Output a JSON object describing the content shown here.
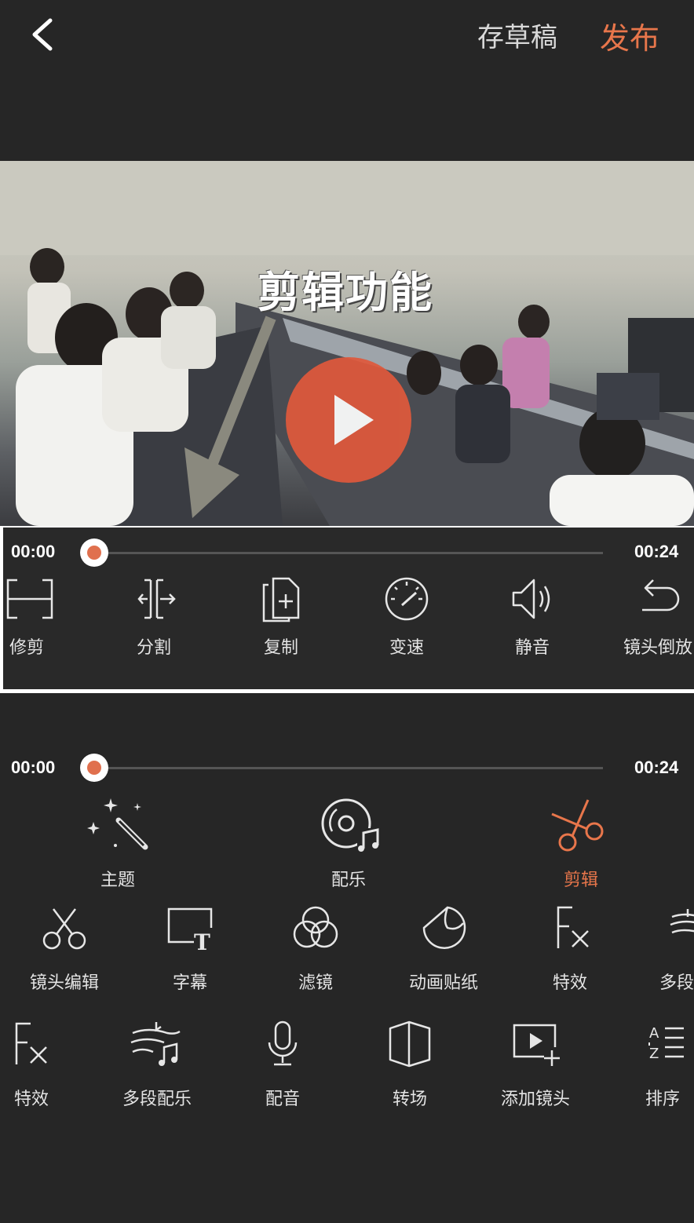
{
  "header": {
    "back_icon": "chevron-left-icon",
    "draft_label": "存草稿",
    "publish_label": "发布",
    "publish_color": "#e8764b"
  },
  "video": {
    "overlay_text": "剪辑功能",
    "play_color": "#e0593c"
  },
  "timeline_top": {
    "start": "00:00",
    "end": "00:24",
    "progress": 0.0
  },
  "edit_tools": [
    {
      "label": "修剪",
      "icon": "trim-icon"
    },
    {
      "label": "分割",
      "icon": "split-icon"
    },
    {
      "label": "复制",
      "icon": "copy-icon"
    },
    {
      "label": "变速",
      "icon": "speedometer-icon"
    },
    {
      "label": "静音",
      "icon": "speaker-icon"
    },
    {
      "label": "镜头倒放",
      "icon": "undo-arrow-icon"
    }
  ],
  "timeline_bottom": {
    "start": "00:00",
    "end": "00:24",
    "progress": 0.0
  },
  "main_tabs": [
    {
      "label": "主题",
      "icon": "magic-wand-icon",
      "active": false
    },
    {
      "label": "配乐",
      "icon": "music-disc-icon",
      "active": false
    },
    {
      "label": "剪辑",
      "icon": "scissors-icon",
      "active": true
    }
  ],
  "tools_row1": [
    {
      "label": "镜头编辑",
      "icon": "scissors-icon"
    },
    {
      "label": "字幕",
      "icon": "subtitle-icon"
    },
    {
      "label": "滤镜",
      "icon": "filter-icon"
    },
    {
      "label": "动画贴纸",
      "icon": "sticker-icon"
    },
    {
      "label": "特效",
      "icon": "fx-icon"
    },
    {
      "label": "多段",
      "icon": "multi-music-icon"
    }
  ],
  "tools_row2": [
    {
      "label": "特效",
      "icon": "fx-icon"
    },
    {
      "label": "多段配乐",
      "icon": "multi-music-icon"
    },
    {
      "label": "配音",
      "icon": "microphone-icon"
    },
    {
      "label": "转场",
      "icon": "transition-icon"
    },
    {
      "label": "添加镜头",
      "icon": "add-clip-icon"
    },
    {
      "label": "排序",
      "icon": "sort-az-icon"
    }
  ],
  "accent_color": "#e8764b"
}
